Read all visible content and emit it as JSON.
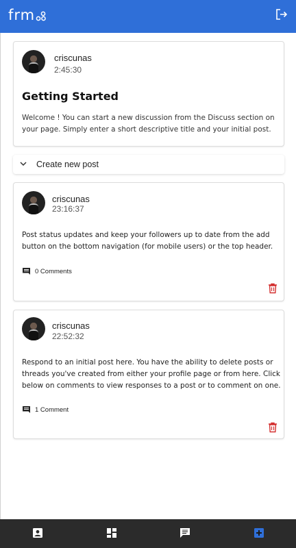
{
  "app": {
    "logo": "frm"
  },
  "intro_card": {
    "username": "criscunas",
    "time": "2:45:30",
    "title": "Getting Started",
    "body": "Welcome ! You can start a new discussion from the Discuss section on your page. Simply enter a short descriptive title and your initial post."
  },
  "create_post": {
    "label": "Create new post"
  },
  "posts": [
    {
      "username": "criscunas",
      "time": "23:16:37",
      "body": "Post status updates and keep your followers up to date from the add button on the bottom navigation (for mobile users) or the top header.",
      "comments": "0 Comments"
    },
    {
      "username": "criscunas",
      "time": "22:52:32",
      "body": "Respond to an initial post here. You have the ability to delete posts or threads you've created from either your profile page or from here. Click below on comments to view responses to a post or to comment on one.",
      "comments": "1 Comment"
    }
  ],
  "icons": {
    "logout": "logout-icon",
    "chevron": "chevron-down-icon",
    "comment": "comment-icon",
    "delete": "trash-icon",
    "nav": [
      "profile-icon",
      "dashboard-icon",
      "chat-icon",
      "add-post-icon"
    ]
  },
  "colors": {
    "appbar": "#2f6fd8",
    "bottom_nav": "#2b2b2b",
    "delete": "#d32f2f",
    "active_nav": "#2f6fd8"
  }
}
